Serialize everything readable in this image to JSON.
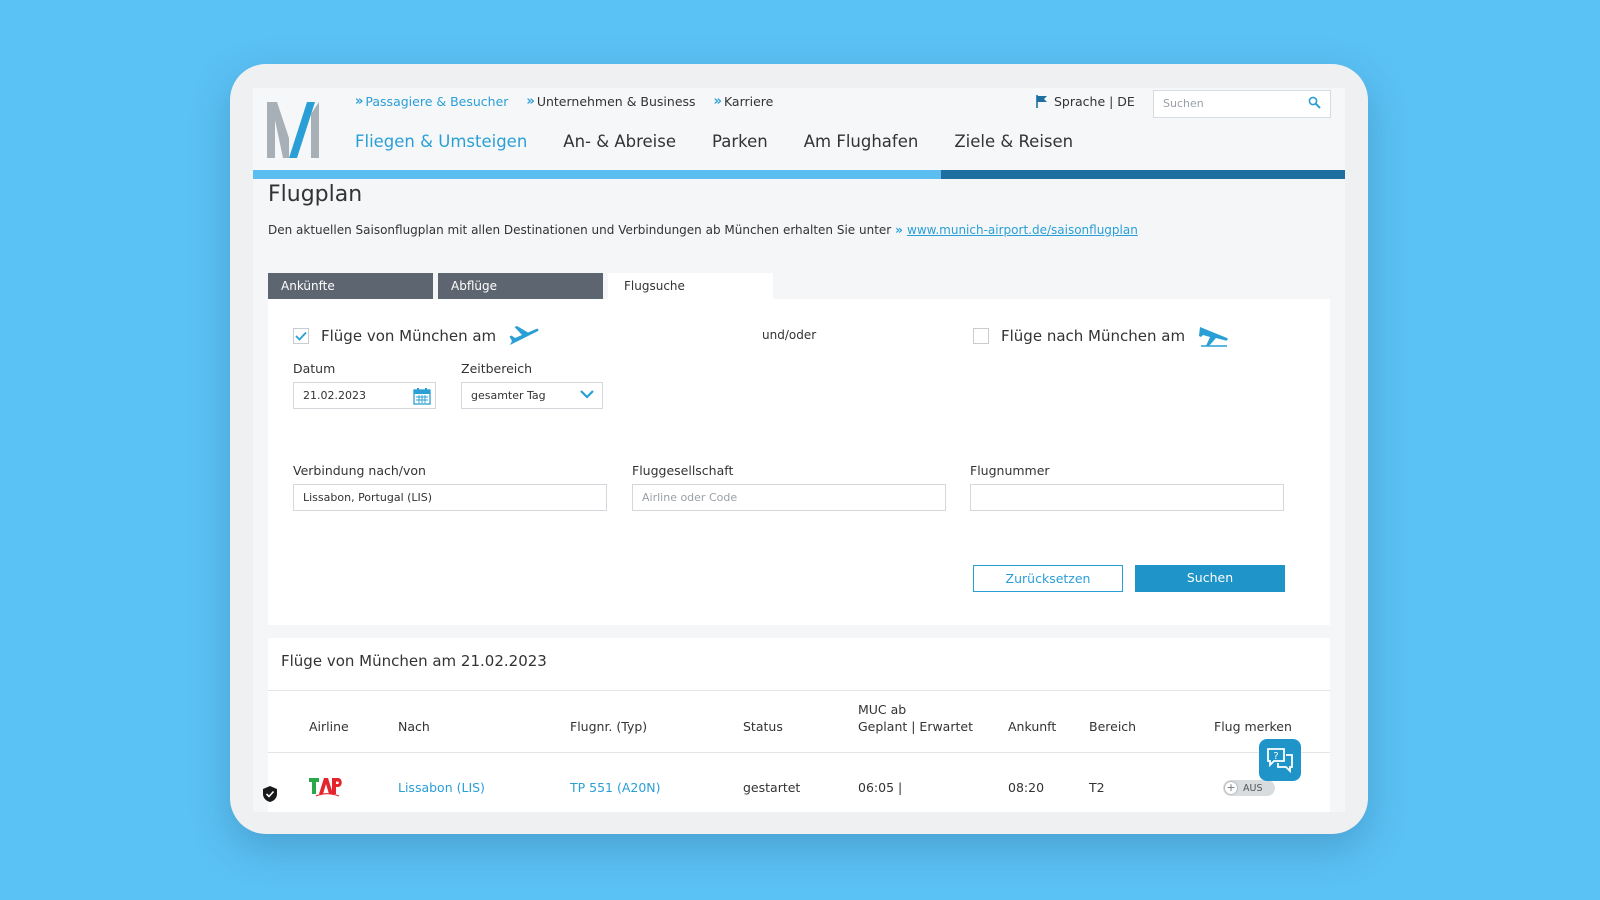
{
  "topnav": {
    "items": [
      {
        "label": "Passagiere & Besucher",
        "active": true
      },
      {
        "label": "Unternehmen & Business",
        "active": false
      },
      {
        "label": "Karriere",
        "active": false
      }
    ],
    "language": "Sprache | DE",
    "search_placeholder": "Suchen"
  },
  "mainnav": {
    "items": [
      {
        "label": "Fliegen & Umsteigen",
        "active": true
      },
      {
        "label": "An- & Abreise",
        "active": false
      },
      {
        "label": "Parken",
        "active": false
      },
      {
        "label": "Am Flughafen",
        "active": false
      },
      {
        "label": "Ziele & Reisen",
        "active": false
      }
    ]
  },
  "page": {
    "title": "Flugplan",
    "intro_text": "Den aktuellen Saisonflugplan mit allen Destinationen und Verbindungen ab München erhalten Sie unter",
    "intro_link": "www.munich-airport.de/saisonflugplan"
  },
  "tabs": [
    {
      "label": "Ankünfte",
      "active": false
    },
    {
      "label": "Abflüge",
      "active": false
    },
    {
      "label": "Flugsuche",
      "active": true
    }
  ],
  "form": {
    "from_munich_label": "Flüge von München am",
    "from_munich_checked": true,
    "and_or": "und/oder",
    "to_munich_label": "Flüge nach München am",
    "to_munich_checked": false,
    "date_label": "Datum",
    "date_value": "21.02.2023",
    "time_label": "Zeitbereich",
    "time_value": "gesamter Tag",
    "connection_label": "Verbindung nach/von",
    "connection_value": "Lissabon, Portugal (LIS)",
    "airline_label": "Fluggesellschaft",
    "airline_placeholder": "Airline oder Code",
    "flightno_label": "Flugnummer",
    "flightno_value": "",
    "reset_label": "Zurücksetzen",
    "search_label": "Suchen"
  },
  "results": {
    "title": "Flüge von München am 21.02.2023",
    "columns": {
      "airline": "Airline",
      "to": "Nach",
      "flightno": "Flugnr. (Typ)",
      "status": "Status",
      "muc_line1": "MUC ab",
      "muc_line2": "Geplant | Erwartet",
      "arrival": "Ankunft",
      "area": "Bereich",
      "remember": "Flug merken"
    },
    "rows": [
      {
        "airline_logo": "TAP",
        "to": "Lissabon (LIS)",
        "flightno": "TP 551 (A20N)",
        "status": "gestartet",
        "departure": "06:05 |",
        "arrival": "08:20",
        "area": "T2",
        "remember": "AUS"
      }
    ]
  },
  "colors": {
    "accent": "#2a9fd6",
    "dark_bar": "#1e6fa0",
    "tab_inactive": "#5d6670",
    "background": "#5bc2f5"
  }
}
